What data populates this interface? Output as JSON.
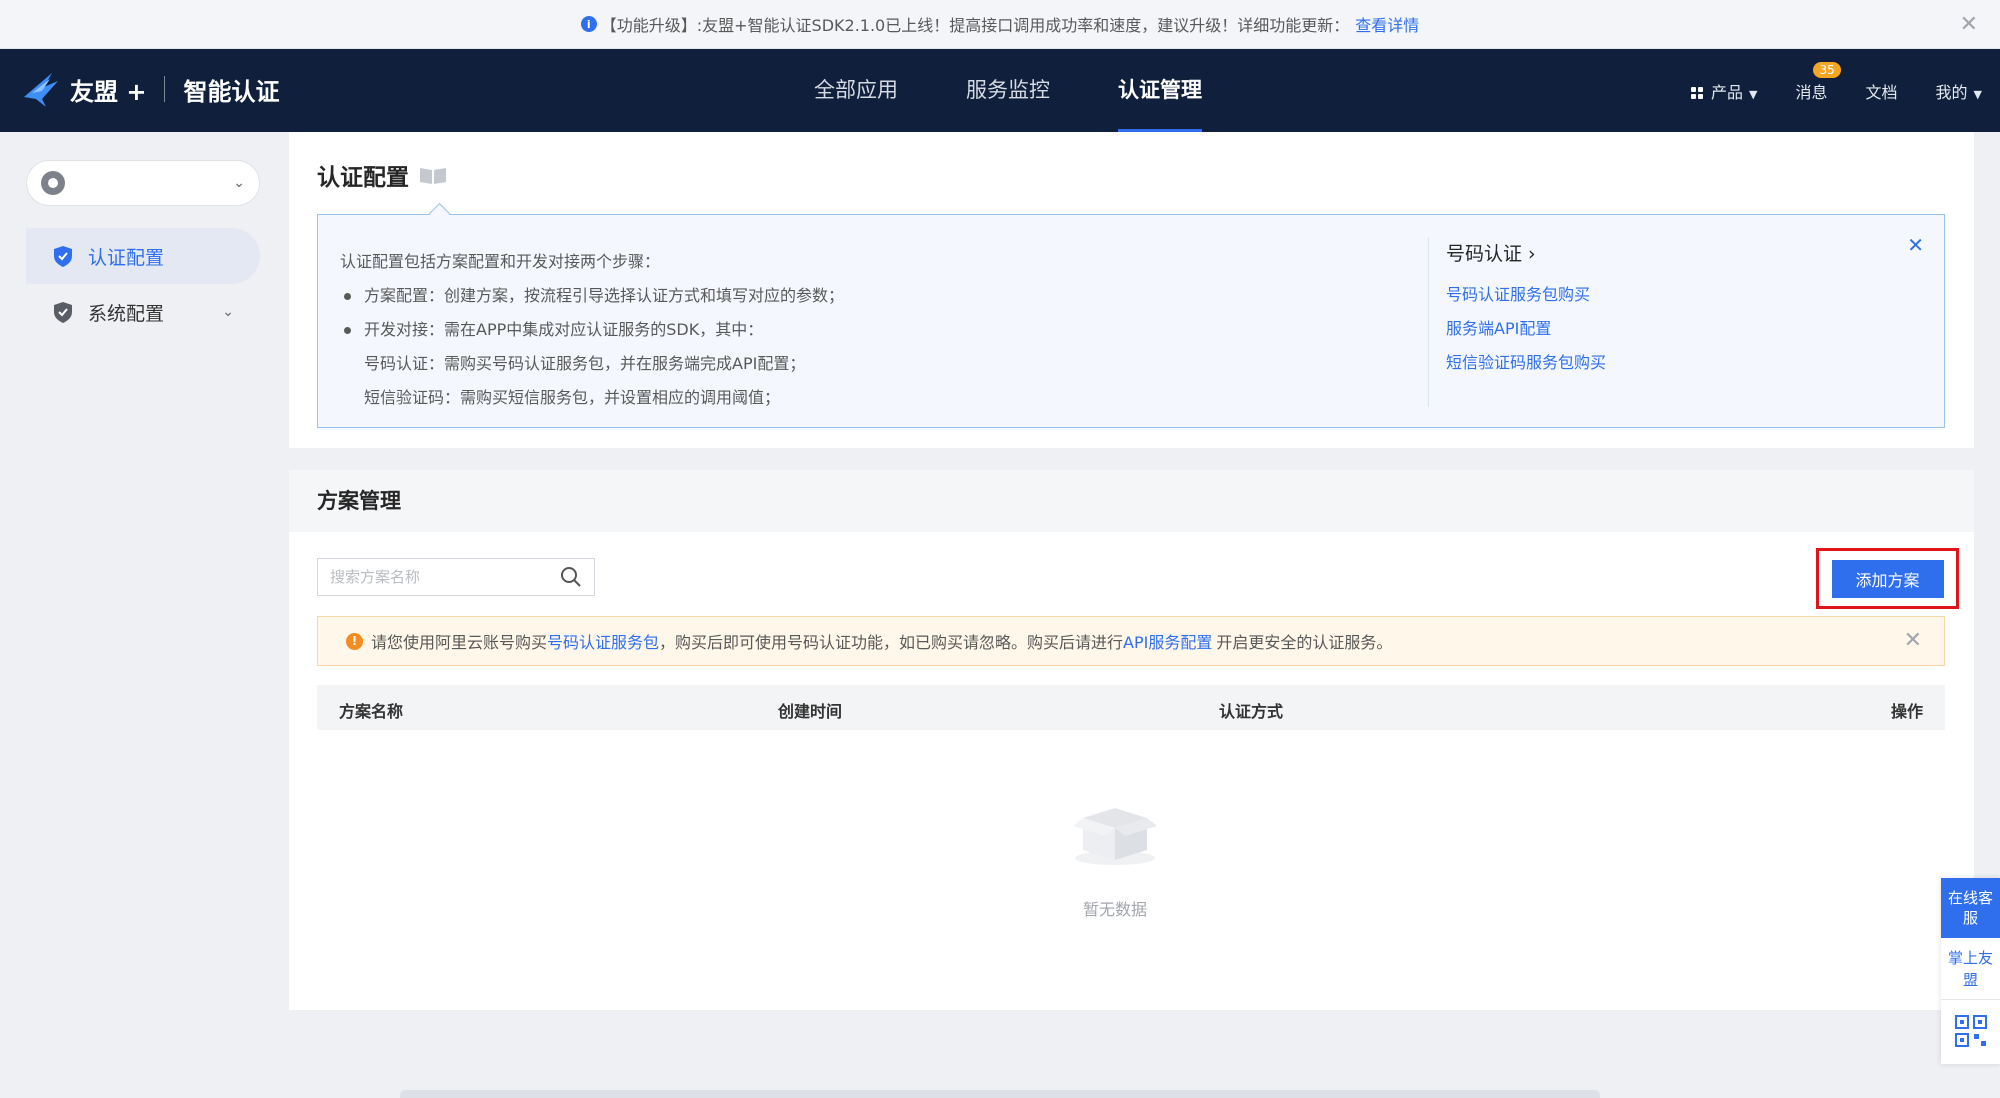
{
  "announcement": {
    "icon": "info-icon",
    "tag": "【功能升级】:",
    "text": "友盟+智能认证SDK2.1.0已上线！提高接口调用成功率和速度，建议升级！详细功能更新：",
    "link": "查看详情"
  },
  "brand": {
    "name": "友盟 +",
    "product": "智能认证"
  },
  "nav": {
    "items": [
      "全部应用",
      "服务监控",
      "认证管理"
    ],
    "active_index": 2,
    "products": "产品",
    "messages": "消息",
    "message_count": "35",
    "docs": "文档",
    "mine": "我的"
  },
  "sidebar": {
    "items": [
      {
        "label": "认证配置",
        "active": true
      },
      {
        "label": "系统配置",
        "active": false
      }
    ]
  },
  "config": {
    "title": "认证配置",
    "intro": "认证配置包括方案配置和开发对接两个步骤：",
    "bullet1": "方案配置：创建方案，按流程引导选择认证方式和填写对应的参数；",
    "bullet2": "开发对接：需在APP中集成对应认证服务的SDK，其中：",
    "sub1": "号码认证：需购买号码认证服务包，并在服务端完成API配置；",
    "sub2": "短信验证码：需购买短信服务包，并设置相应的调用阈值；",
    "right_title": "号码认证 ›",
    "links": [
      "号码认证服务包购买",
      "服务端API配置",
      "短信验证码服务包购买"
    ]
  },
  "plan": {
    "title": "方案管理",
    "search_placeholder": "搜索方案名称",
    "add_button": "添加方案",
    "warning": {
      "pre": "请您使用阿里云账号购买",
      "link1": "号码认证服务包",
      "mid": "，购买后即可使用号码认证功能，如已购买请忽略。购买后请进行",
      "link2": "API服务配置",
      "post": "开启更安全的认证服务。"
    },
    "columns": [
      "方案名称",
      "创建时间",
      "认证方式",
      "操作"
    ],
    "empty_text": "暂无数据"
  },
  "float_panel": {
    "service": "在线客服",
    "app": "掌上友盟"
  },
  "colors": {
    "accent": "#2f6fed",
    "nav_bg": "#10203c",
    "highlight": "#e1131c",
    "warning": "#f58c1f"
  }
}
